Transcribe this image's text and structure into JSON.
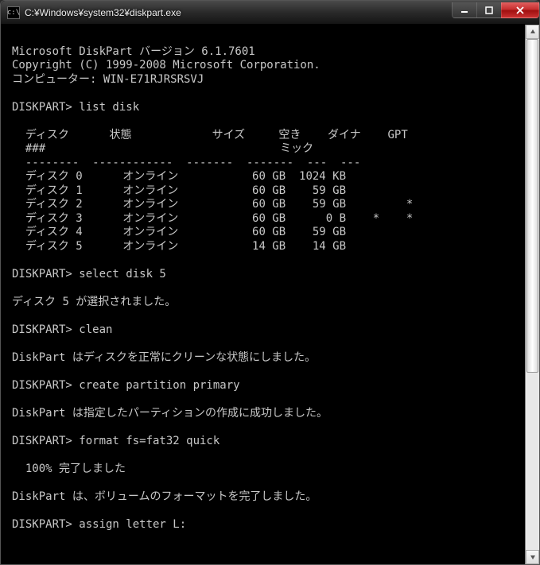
{
  "window": {
    "title": "C:¥Windows¥system32¥diskpart.exe"
  },
  "header": {
    "line1": "Microsoft DiskPart バージョン 6.1.7601",
    "line2": "Copyright (C) 1999-2008 Microsoft Corporation.",
    "line3": "コンピューター: WIN-E71RJRSRSVJ"
  },
  "prompt": "DISKPART>",
  "commands": {
    "c1": "list disk",
    "c2": "select disk 5",
    "c3": "clean",
    "c4": "create partition primary",
    "c5": "format fs=fat32 quick",
    "c6": "assign letter L:"
  },
  "table": {
    "head": {
      "col1a": "ディスク",
      "col1b": "###",
      "col2": "状態",
      "col3": "サイズ",
      "col4": "空き",
      "col5a": "ダイナ",
      "col5b": "ミック",
      "col6": "GPT"
    },
    "divider": "  --------  ------------  -------  -------  ---  ---",
    "rows": [
      {
        "name": "ディスク 0",
        "state": "オンライン",
        "size": "60 GB",
        "free": "1024 KB",
        "dyn": " ",
        "gpt": " "
      },
      {
        "name": "ディスク 1",
        "state": "オンライン",
        "size": "60 GB",
        "free": "59 GB",
        "dyn": " ",
        "gpt": " "
      },
      {
        "name": "ディスク 2",
        "state": "オンライン",
        "size": "60 GB",
        "free": "59 GB",
        "dyn": " ",
        "gpt": "*"
      },
      {
        "name": "ディスク 3",
        "state": "オンライン",
        "size": "60 GB",
        "free": "0 B",
        "dyn": "*",
        "gpt": "*"
      },
      {
        "name": "ディスク 4",
        "state": "オンライン",
        "size": "60 GB",
        "free": "59 GB",
        "dyn": " ",
        "gpt": " "
      },
      {
        "name": "ディスク 5",
        "state": "オンライン",
        "size": "14 GB",
        "free": "14 GB",
        "dyn": " ",
        "gpt": " "
      }
    ]
  },
  "responses": {
    "r2": "ディスク 5 が選択されました。",
    "r3": "DiskPart はディスクを正常にクリーンな状態にしました。",
    "r4": "DiskPart は指定したパーティションの作成に成功しました。",
    "r5a": "  100% 完了しました",
    "r5b": "DiskPart は、ボリュームのフォーマットを完了しました。"
  }
}
